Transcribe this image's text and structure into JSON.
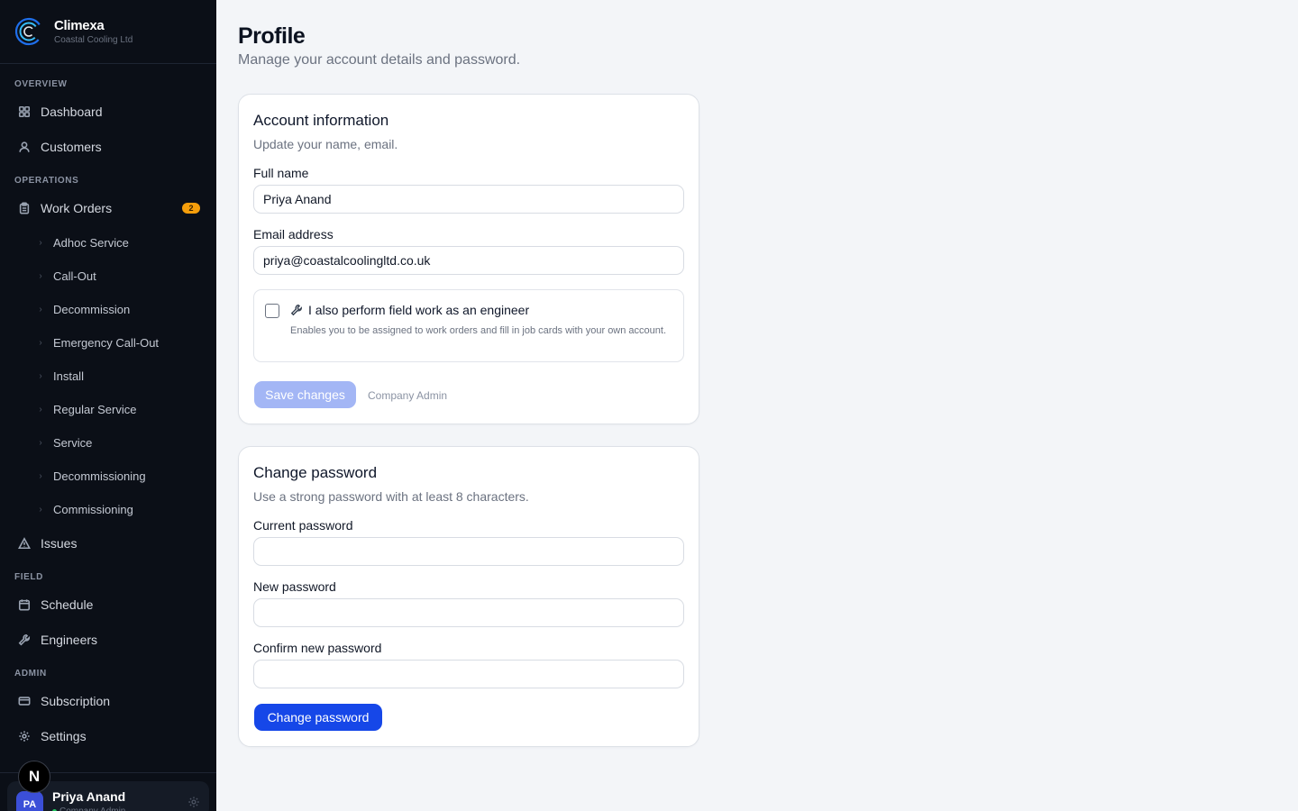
{
  "brand": {
    "name": "Climexa",
    "company": "Coastal Cooling Ltd"
  },
  "sidebar": {
    "sections": {
      "overview": "OVERVIEW",
      "operations": "OPERATIONS",
      "field": "FIELD",
      "admin": "ADMIN"
    },
    "items": {
      "dashboard": "Dashboard",
      "customers": "Customers",
      "work_orders": "Work Orders",
      "work_orders_badge": "2",
      "issues": "Issues",
      "schedule": "Schedule",
      "engineers": "Engineers",
      "subscription": "Subscription",
      "settings": "Settings"
    },
    "work_order_types": [
      "Adhoc Service",
      "Call-Out",
      "Decommission",
      "Emergency Call-Out",
      "Install",
      "Regular Service",
      "Service",
      "Decommissioning",
      "Commissioning"
    ],
    "user": {
      "initials": "PA",
      "name": "Priya Anand",
      "role": "Company Admin"
    },
    "n_badge": "N"
  },
  "page": {
    "title": "Profile",
    "subtitle": "Manage your account details and password."
  },
  "account": {
    "title": "Account information",
    "subtitle": "Update your name, email.",
    "full_name_label": "Full name",
    "full_name_value": "Priya Anand",
    "email_label": "Email address",
    "email_value": "priya@coastalcoolingltd.co.uk",
    "engineer_title": "I also perform field work as an engineer",
    "engineer_desc": "Enables you to be assigned to work orders and fill in job cards with your own account.",
    "engineer_checked": false,
    "save_label": "Save changes",
    "role_hint": "Company Admin"
  },
  "password": {
    "title": "Change password",
    "subtitle": "Use a strong password with at least 8 characters.",
    "current_label": "Current password",
    "new_label": "New password",
    "confirm_label": "Confirm new password",
    "current_value": "",
    "new_value": "",
    "confirm_value": "",
    "submit_label": "Change password"
  },
  "colors": {
    "sidebar_bg": "#0b0f17",
    "accent": "#1647e8",
    "accent_disabled": "#a3b6f5",
    "badge": "#f59e0b",
    "avatar": "#3b4fd8",
    "status_online": "#22c55e"
  }
}
